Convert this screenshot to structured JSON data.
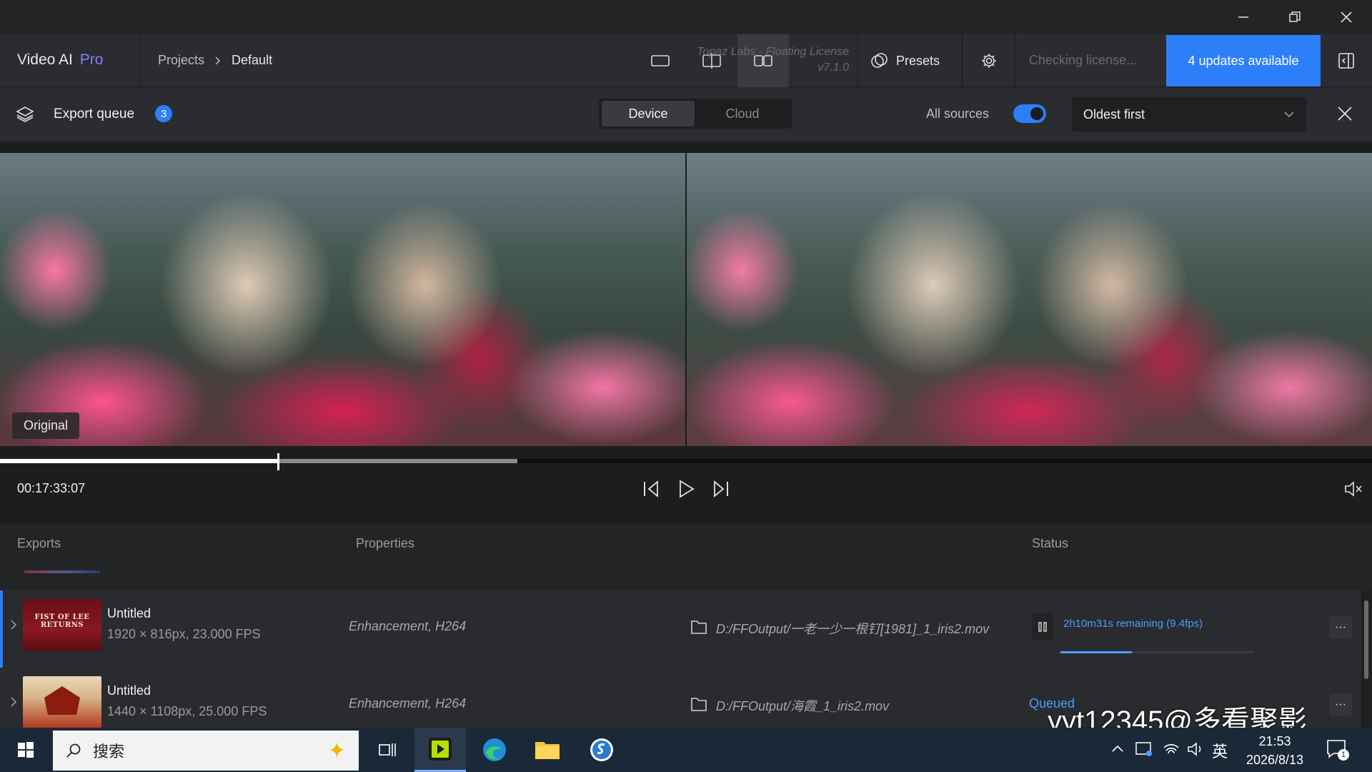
{
  "app": {
    "name": "Video AI",
    "edition": "Pro",
    "license_title": "Topaz Labs - Floating License",
    "version": "v7.1.0",
    "license_status": "Checking license...",
    "updates_label": "4 updates available"
  },
  "breadcrumb": {
    "projects": "Projects",
    "current": "Default"
  },
  "header": {
    "presets_label": "Presets"
  },
  "queue_bar": {
    "title": "Export queue",
    "count": "3",
    "tabs": [
      "Device",
      "Cloud"
    ],
    "active_tab": "Device",
    "all_sources_label": "All sources",
    "all_sources_on": true,
    "sort_value": "Oldest first"
  },
  "preview": {
    "left_label": "Original"
  },
  "player": {
    "timecode": "00:17:33:07"
  },
  "table": {
    "headers": {
      "exports": "Exports",
      "properties": "Properties",
      "status": "Status"
    },
    "rows": [
      {
        "name": "Untitled",
        "specs": "1920 × 816px, 23.000 FPS",
        "thumb_text": "FIST OF LEE RETURNS",
        "properties": "Enhancement, H264",
        "path": "D:/FFOutput/一老一少一根钉[1981]_1_iris2.mov",
        "status": "2h10m31s remaining (9.4fps)",
        "progress": 0.37
      },
      {
        "name": "Untitled",
        "specs": "1440 × 1108px, 25.000 FPS",
        "properties": "Enhancement, H264",
        "path": "D:/FFOutput/海霞_1_iris2.mov",
        "status": "Queued"
      }
    ]
  },
  "watermark": {
    "text": "yyt12345@多看聚影"
  },
  "taskbar": {
    "search_placeholder": "搜索",
    "ime": "英",
    "time": "21:53",
    "date": "2026/8/13",
    "notifications": "1"
  },
  "colors": {
    "accent": "#2d7ff9",
    "edition": "#8a7cff",
    "background": "#1c1d1f"
  }
}
